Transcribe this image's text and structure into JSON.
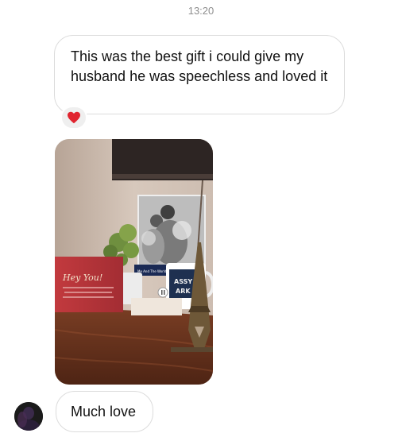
{
  "chat": {
    "timestamp": "13:20",
    "messages": [
      {
        "type": "text",
        "text": "This was the best gift i could give my husband he was speechless and loved it",
        "reaction": "heart"
      },
      {
        "type": "photo",
        "card_text": "Hey You!",
        "mug_text_1": "ASSY",
        "mug_text_2": "ARK",
        "plaque_caption": "Me And The World"
      },
      {
        "type": "text",
        "text": "Much love"
      }
    ]
  },
  "colors": {
    "bubble_border": "#dcdcdc",
    "reaction_heart": "#e0242f",
    "card_red": "#b8343a",
    "timestamp": "#8e8e8e"
  }
}
